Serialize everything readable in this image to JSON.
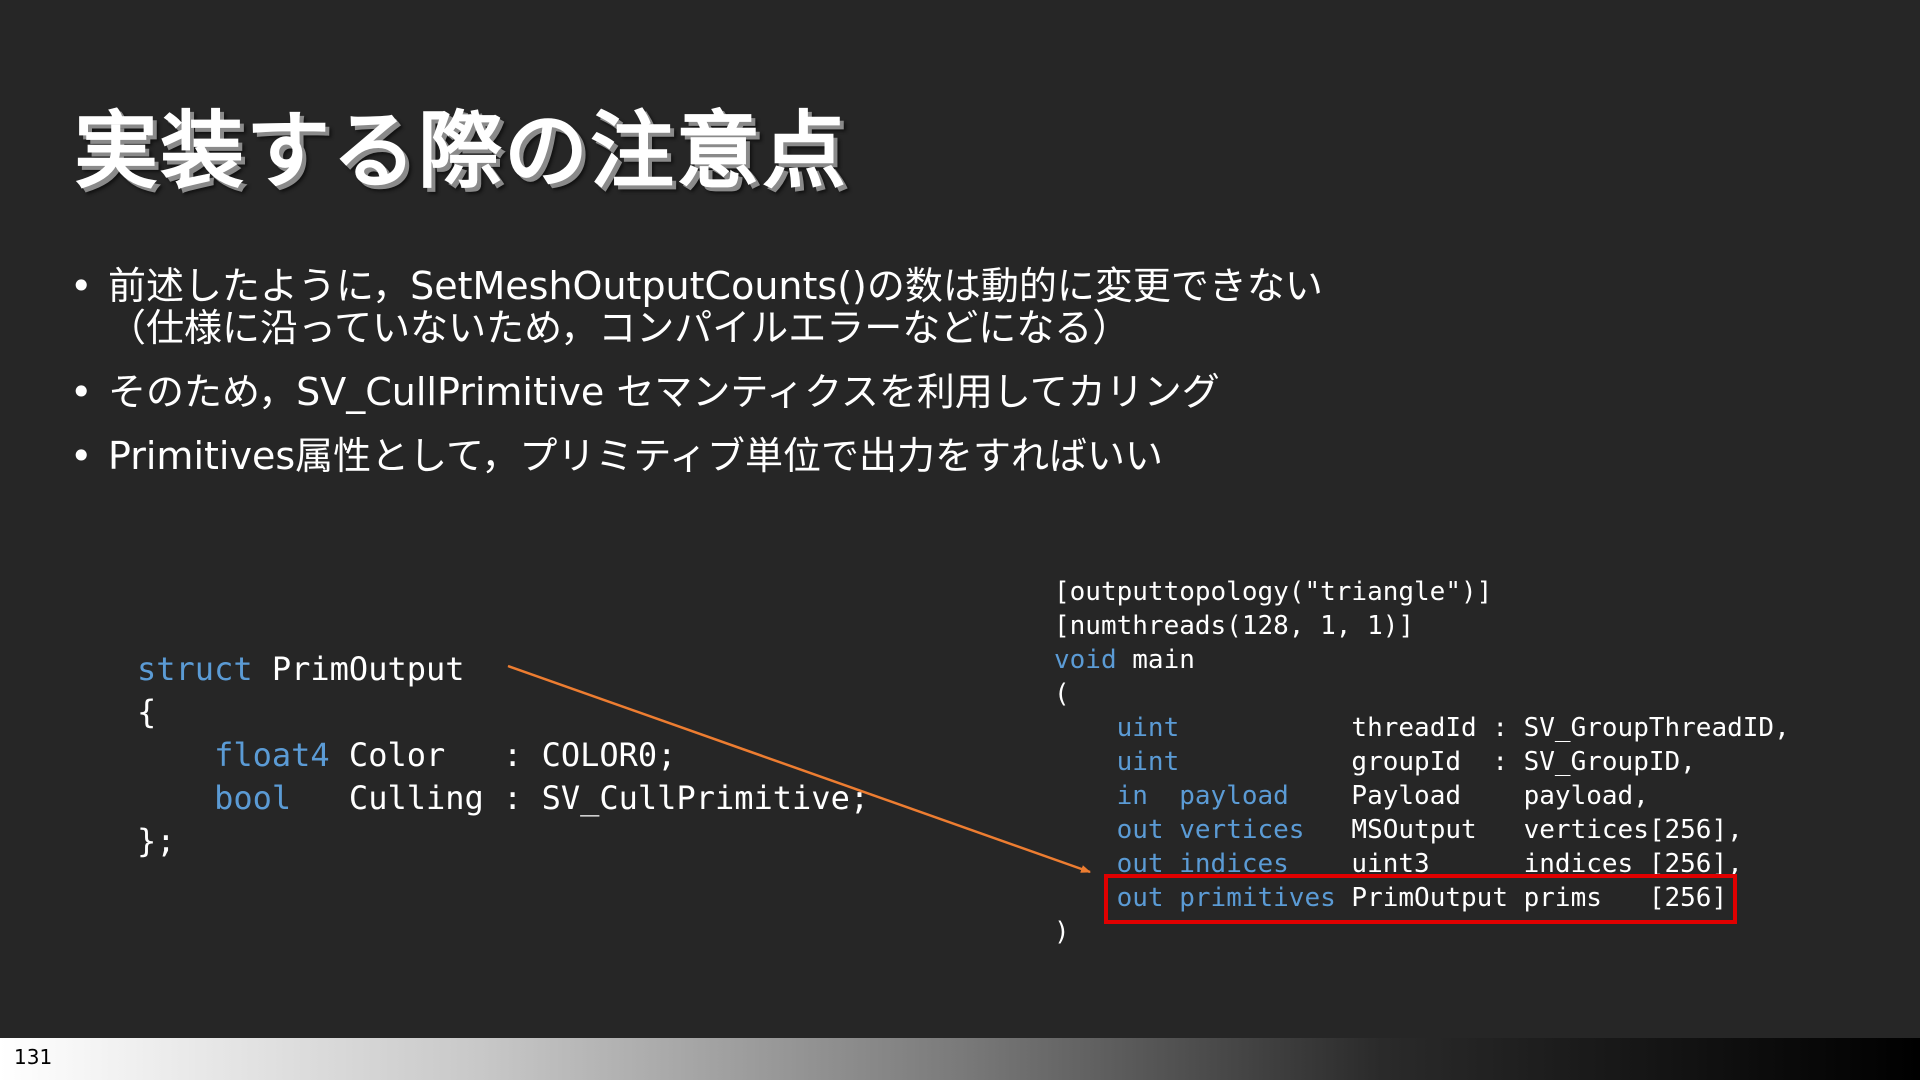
{
  "slide": {
    "title": "実装する際の注意点",
    "bullets": [
      {
        "line1": "前述したように，SetMeshOutputCounts()の数は動的に変更できない",
        "line2": "（仕様に沿っていないため，コンパイルエラーなどになる）"
      },
      {
        "line1": "そのため，SV_CullPrimitive セマンティクスを利用してカリング",
        "line2": ""
      },
      {
        "line1": "Primitives属性として，プリミティブ単位で出力をすればいい",
        "line2": ""
      }
    ],
    "bullet_char": "•",
    "page_number": "131"
  },
  "code_left": {
    "l1_kw": "struct",
    "l1_rest": " PrimOutput",
    "l2": "{",
    "l3_indent": "    ",
    "l3_kw": "float4",
    "l3_rest": " Color   : COLOR0;",
    "l4_indent": "    ",
    "l4_kw": "bool",
    "l4_rest": "   Culling : SV_CullPrimitive;",
    "l5": "};"
  },
  "code_right": {
    "l1": "[outputtopology(\"triangle\")]",
    "l2": "[numthreads(128, 1, 1)]",
    "l3_kw": "void",
    "l3_rest": " main",
    "l4": "(",
    "l5_indent": "    ",
    "l5_kw": "uint",
    "l5_rest": "           threadId : SV_GroupThreadID,",
    "l6_indent": "    ",
    "l6_kw": "uint",
    "l6_rest": "           groupId  : SV_GroupID,",
    "l7_indent": "    ",
    "l7_kw": "in  payload",
    "l7_rest": "    Payload    payload,",
    "l8_indent": "    ",
    "l8_kw": "out vertices",
    "l8_rest": "   MSOutput   vertices[256],",
    "l9_indent": "    ",
    "l9_kw": "out indices",
    "l9_rest": "    uint3      indices [256],",
    "l10_indent": "    ",
    "l10_kw": "out primitives",
    "l10_rest": " PrimOutput prims   [256]",
    "l11": ")"
  },
  "colors": {
    "background": "#262626",
    "keyword": "#5b9bd5",
    "arrow": "#ed7d31",
    "highlight_border": "#e00000"
  }
}
